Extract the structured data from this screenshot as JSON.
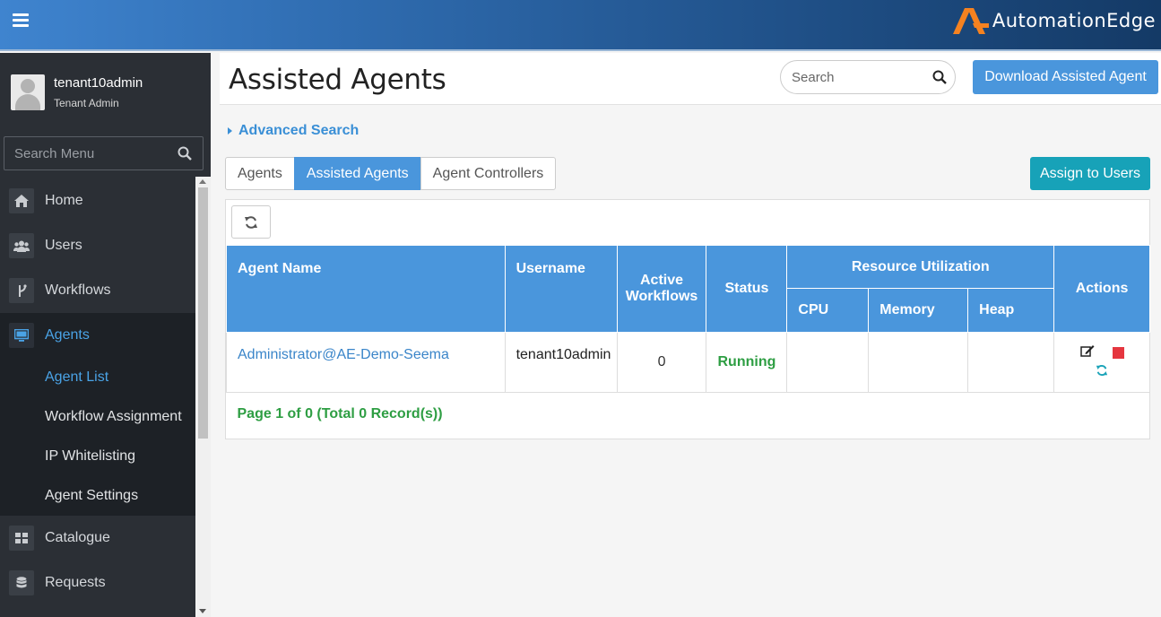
{
  "app": {
    "logo_text": "AutomationEdge",
    "brand_color": "#f58220"
  },
  "sidebar": {
    "user_name": "tenant10admin",
    "user_role": "Tenant Admin",
    "search_placeholder": "Search Menu",
    "items": [
      {
        "label": "Home",
        "icon": "home-icon"
      },
      {
        "label": "Users",
        "icon": "users-icon"
      },
      {
        "label": "Workflows",
        "icon": "workflows-icon"
      },
      {
        "label": "Agents",
        "icon": "monitor-icon",
        "active": true
      },
      {
        "label": "Catalogue",
        "icon": "grid-icon"
      },
      {
        "label": "Requests",
        "icon": "database-icon"
      }
    ],
    "agents_sub": [
      {
        "label": "Agent List",
        "active": true
      },
      {
        "label": "Workflow Assignment"
      },
      {
        "label": "IP Whitelisting"
      },
      {
        "label": "Agent Settings"
      }
    ]
  },
  "header": {
    "title": "Assisted Agents",
    "search_placeholder": "Search",
    "download_label": "Download Assisted Agent"
  },
  "advanced_search_label": "Advanced Search",
  "tabs": [
    {
      "label": "Agents",
      "active": false
    },
    {
      "label": "Assisted Agents",
      "active": true
    },
    {
      "label": "Agent Controllers",
      "active": false
    }
  ],
  "assign_label": "Assign to Users",
  "table": {
    "headers": {
      "agent_name": "Agent Name",
      "username": "Username",
      "active_workflows": "Active Workflows",
      "status": "Status",
      "resource_utilization": "Resource Utilization",
      "cpu": "CPU",
      "memory": "Memory",
      "heap": "Heap",
      "actions": "Actions"
    },
    "rows": [
      {
        "agent_name": "Administrator@AE-Demo-Seema",
        "username": "tenant10admin",
        "active_workflows": "0",
        "status": "Running",
        "cpu": "",
        "memory": "",
        "heap": ""
      }
    ],
    "pager": "Page 1 of 0 (Total 0 Record(s))"
  }
}
